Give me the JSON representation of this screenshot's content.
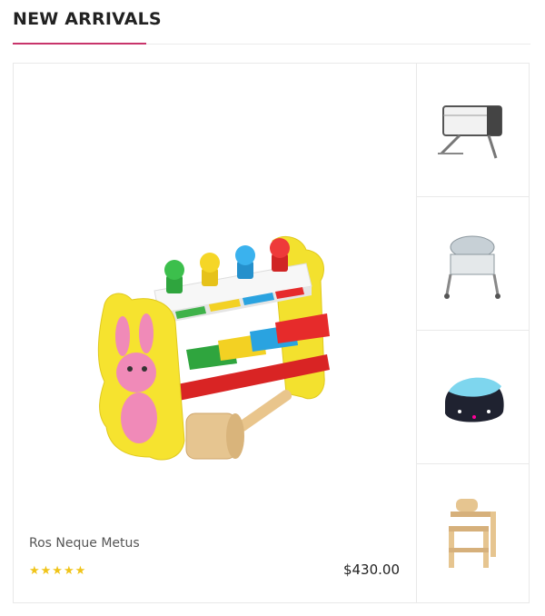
{
  "section": {
    "title": "NEW ARRIVALS"
  },
  "featured": {
    "name": "Ros Neque Metus",
    "rating": 5,
    "rating_display": "★★★★★",
    "price": "$430.00",
    "image_icon": "wooden-pound-toy-image"
  },
  "thumbnails": [
    {
      "icon": "bedside-crib-image"
    },
    {
      "icon": "bassinet-playard-image"
    },
    {
      "icon": "bean-bag-chair-image"
    },
    {
      "icon": "wooden-high-chair-image"
    }
  ],
  "colors": {
    "accent": "#c8346b",
    "star": "#f0c419"
  }
}
